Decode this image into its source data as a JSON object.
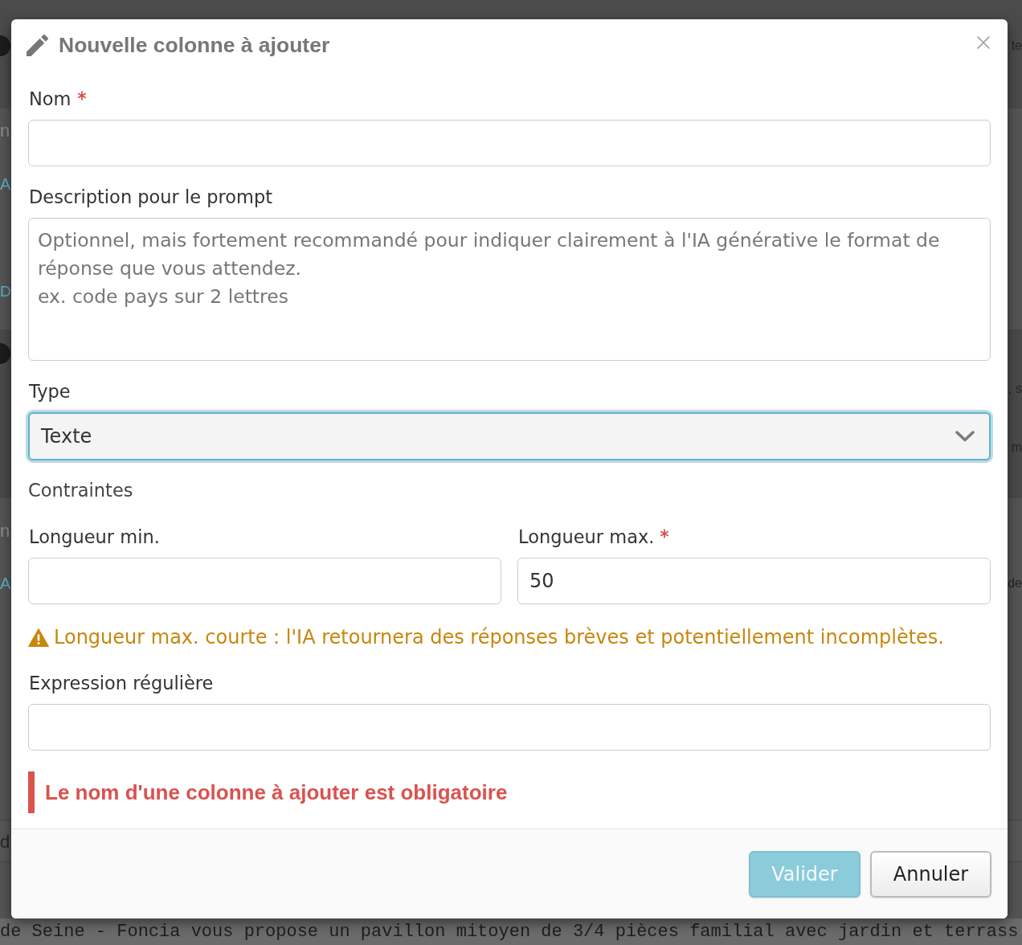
{
  "background": {
    "lines": [
      {
        "kind": "dot",
        "right": "te"
      },
      {
        "kind": "text",
        "left": "n"
      },
      {
        "kind": "link",
        "left": "A"
      },
      {
        "kind": "heading",
        "left": "D"
      },
      {
        "kind": "dot"
      },
      {
        "kind": "text",
        "right": ", s"
      },
      {
        "kind": "text",
        "right": "m"
      },
      {
        "kind": "text",
        "left": "n"
      },
      {
        "kind": "link",
        "left": "A",
        "right": "de"
      },
      {
        "kind": "dark",
        "left": "d"
      }
    ],
    "footer_text": "de Seine - Foncia vous propose un pavillon mitoyen de 3/4 pièces familial avec jardin et terrass"
  },
  "dialog": {
    "title": "Nouvelle colonne à ajouter",
    "fields": [
      {
        "kind": "text",
        "label": "Nom",
        "required": true,
        "focused": false
      },
      {
        "kind": "textarea",
        "label": "Description pour le prompt",
        "required": false,
        "focused": false,
        "placeholder": "Optionnel, mais fortement recommandé pour indiquer clairement à l'IA générative le format de réponse que vous attendez.\nex. code pays sur 2 lettres"
      },
      {
        "kind": "select",
        "label": "Type",
        "required": false,
        "focused": true,
        "value": "Texte"
      }
    ],
    "constraints": {
      "title": "Contraintes",
      "fields": [
        {
          "label": "Longueur min.",
          "required": false,
          "focused": false
        },
        {
          "label": "Longueur max.",
          "required": true,
          "focused": false,
          "value": "50"
        }
      ],
      "warning": "Longueur max. courte : l'IA retournera des réponses brèves et potentiellement incomplètes.",
      "regex": {
        "label": "Expression régulière",
        "required": false,
        "focused": false
      }
    },
    "error": "Le nom d'une colonne à ajouter est obligatoire",
    "buttons": [
      {
        "label": "Valider",
        "kind": "primary",
        "disabled": true
      },
      {
        "label": "Annuler",
        "kind": "default",
        "disabled": false
      }
    ]
  }
}
